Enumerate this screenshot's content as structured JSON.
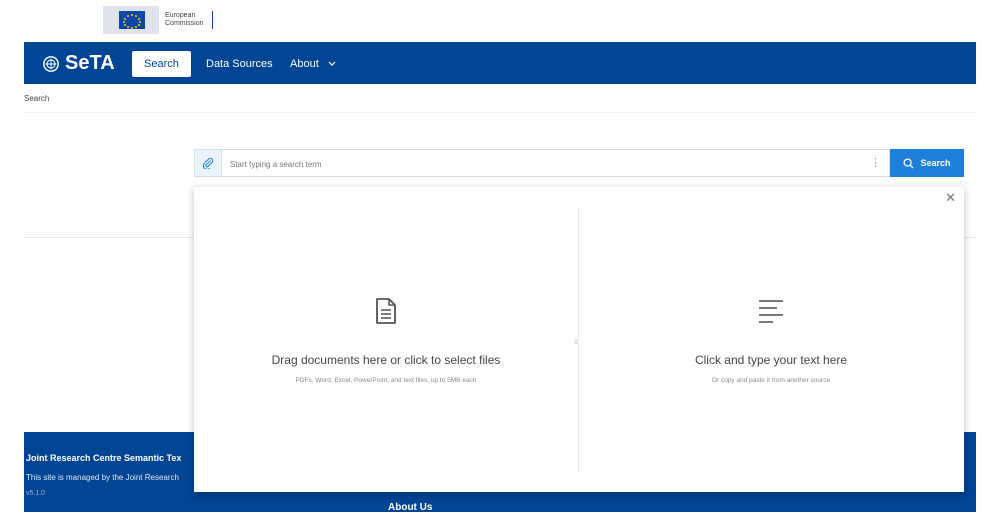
{
  "ec": {
    "logo_line1": "European",
    "logo_line2": "Commission"
  },
  "nav": {
    "brand": "SeTA",
    "tabs": [
      {
        "label": "Search",
        "active": true
      },
      {
        "label": "Data Sources",
        "active": false
      },
      {
        "label": "About",
        "active": false,
        "has_dropdown": true
      }
    ]
  },
  "breadcrumb": "Search",
  "search": {
    "placeholder": "Start typing a search term",
    "button_label": "Search"
  },
  "upload_panel": {
    "documents_title": "Drag documents here or click to select files",
    "documents_hint": "PDFs, Word, Excel, PowerPoint, and text files, up to 5MB each",
    "separator": "or",
    "text_title": "Click and type your text here",
    "text_hint": "Or copy and paste it from another source"
  },
  "footer": {
    "title": "Joint Research Centre Semantic Tex",
    "managed_by": "This site is managed by the Joint Research",
    "version": "v5.1.0",
    "about_heading": "About Us"
  },
  "colors": {
    "nav_bg": "#004494",
    "search_button": "#1e7fd8"
  },
  "icons": [
    "paperclip-icon",
    "kebab-icon",
    "search-icon",
    "close-icon",
    "document-icon",
    "text-lines-icon",
    "chevron-down-icon"
  ]
}
